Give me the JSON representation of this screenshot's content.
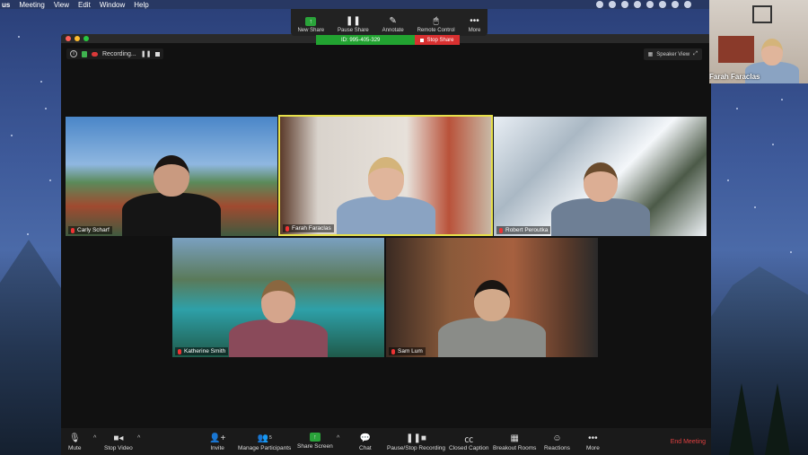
{
  "menubar": {
    "app_fragment": "us",
    "items": [
      "Meeting",
      "View",
      "Edit",
      "Window",
      "Help"
    ]
  },
  "share_toolbar": {
    "items": [
      {
        "label": "New Share",
        "icon": "new-share-icon"
      },
      {
        "label": "Pause Share",
        "icon": "pause-icon"
      },
      {
        "label": "Annotate",
        "icon": "pen-icon"
      },
      {
        "label": "Remote Control",
        "icon": "mouse-icon"
      },
      {
        "label": "More",
        "icon": "more-dots-icon"
      }
    ],
    "meeting_id": "ID: 995-405-329",
    "stop_share": "Stop Share"
  },
  "window": {
    "recording_label": "Recording...",
    "speaker_view_label": "Speaker View"
  },
  "participants": [
    {
      "name": "Carly Scharf"
    },
    {
      "name": "Farah Faraclas",
      "active_speaker": true
    },
    {
      "name": "Robert Peroutka"
    },
    {
      "name": "Katherine Smith"
    },
    {
      "name": "Sam Lum"
    }
  ],
  "self_view": {
    "name": "Farah Faraclas"
  },
  "toolbar": {
    "mute": "Mute",
    "stop_video": "Stop Video",
    "invite": "Invite",
    "manage_participants": "Manage Participants",
    "participant_count": "5",
    "share_screen": "Share Screen",
    "chat": "Chat",
    "pause_stop_recording": "Pause/Stop Recording",
    "closed_caption": "Closed Caption",
    "breakout_rooms": "Breakout Rooms",
    "reactions": "Reactions",
    "more": "More",
    "end_meeting": "End Meeting"
  },
  "colors": {
    "accent_green": "#2aa33a",
    "stop_red": "#d83030",
    "active_speaker_border": "#e6e04a",
    "end_meeting": "#e04040"
  }
}
